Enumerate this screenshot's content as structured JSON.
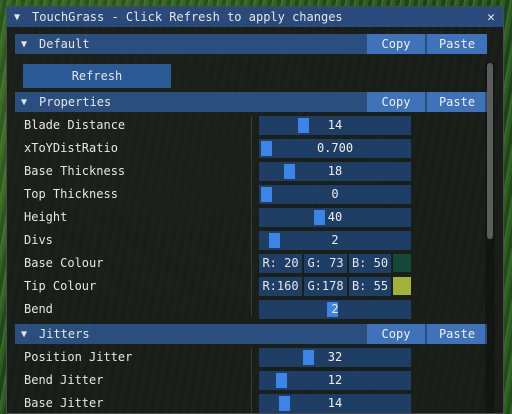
{
  "window": {
    "title": "TouchGrass - Click Refresh to apply changes",
    "close_glyph": "✕",
    "collapse_glyph": "▼"
  },
  "sections": {
    "default": {
      "title": "Default",
      "copy_label": "Copy",
      "paste_label": "Paste"
    },
    "properties": {
      "title": "Properties",
      "copy_label": "Copy",
      "paste_label": "Paste"
    },
    "jitters": {
      "title": "Jitters",
      "copy_label": "Copy",
      "paste_label": "Paste"
    }
  },
  "refresh_label": "Refresh",
  "properties": [
    {
      "label": "Blade Distance",
      "value": "14",
      "fraction": 0.27
    },
    {
      "label": "xToYDistRatio",
      "value": "0.700",
      "fraction": 0.0
    },
    {
      "label": "Base Thickness",
      "value": "18",
      "fraction": 0.17
    },
    {
      "label": "Top Thickness",
      "value": "0",
      "fraction": 0.0
    },
    {
      "label": "Height",
      "value": "40",
      "fraction": 0.39
    },
    {
      "label": "Divs",
      "value": "2",
      "fraction": 0.06
    },
    {
      "label": "Bend",
      "value": "2",
      "fraction": 0.48
    }
  ],
  "base_colour": {
    "label": "Base Colour",
    "r": "R: 20",
    "g": "G: 73",
    "b": "B: 50",
    "swatch": "#14493a"
  },
  "tip_colour": {
    "label": "Tip Colour",
    "r": "R:160",
    "g": "G:178",
    "b": "B: 55",
    "swatch": "#a0b237"
  },
  "jitters": [
    {
      "label": "Position Jitter",
      "value": "32",
      "fraction": 0.31
    },
    {
      "label": "Bend Jitter",
      "value": "12",
      "fraction": 0.11
    },
    {
      "label": "Base Jitter",
      "value": "14",
      "fraction": 0.13
    }
  ],
  "colors": {
    "accent": "#3d84e8",
    "header": "#2a4f7e",
    "button": "#3f72b8",
    "frame": "#1e3e66"
  }
}
